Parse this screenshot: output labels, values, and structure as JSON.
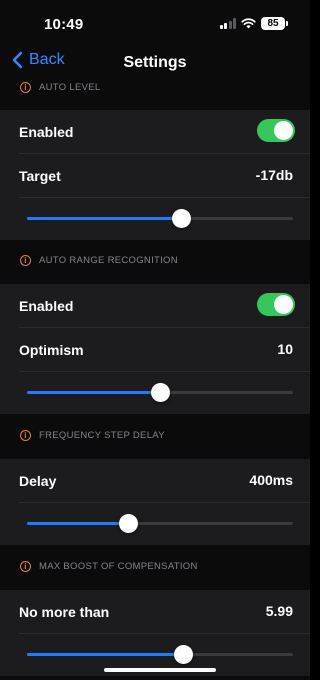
{
  "status_bar": {
    "time": "10:49",
    "battery": "85",
    "icons": [
      "signal-icon",
      "wifi-icon",
      "battery-icon"
    ]
  },
  "nav": {
    "back_label": "Back",
    "title": "Settings"
  },
  "colors": {
    "accent": "#2f8cff",
    "toggle_on": "#34c759",
    "slider_fill": "#1f7bff",
    "info_icon": "#e4813a"
  },
  "sections": [
    {
      "header": "AUTO LEVEL",
      "rows": [
        {
          "label": "Enabled",
          "toggle": true
        },
        {
          "label": "Target",
          "value": "-17db"
        }
      ],
      "slider_fraction": 0.58
    },
    {
      "header": "AUTO RANGE RECOGNITION",
      "rows": [
        {
          "label": "Enabled",
          "toggle": true
        },
        {
          "label": "Optimism",
          "value": "10"
        }
      ],
      "slider_fraction": 0.5
    },
    {
      "header": "FREQUENCY STEP DELAY",
      "rows": [
        {
          "label": "Delay",
          "value": "400ms"
        }
      ],
      "slider_fraction": 0.38
    },
    {
      "header": "MAX BOOST OF COMPENSATION",
      "rows": [
        {
          "label": "No more than",
          "value": "5.99"
        }
      ],
      "slider_fraction": 0.59
    }
  ]
}
